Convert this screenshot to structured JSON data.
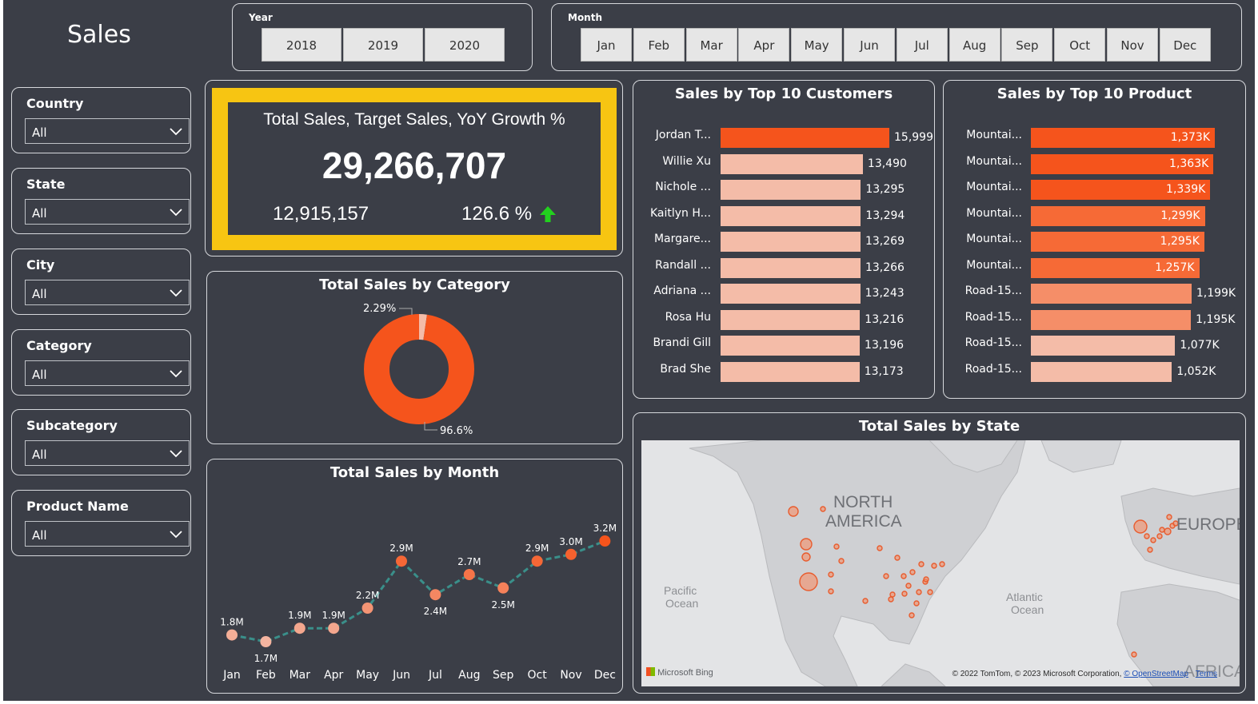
{
  "page_title": "Sales",
  "year_slicer": {
    "label": "Year",
    "options": [
      "2018",
      "2019",
      "2020"
    ]
  },
  "month_slicer": {
    "label": "Month",
    "options": [
      "Jan",
      "Feb",
      "Mar",
      "Apr",
      "May",
      "Jun",
      "Jul",
      "Aug",
      "Sep",
      "Oct",
      "Nov",
      "Dec"
    ]
  },
  "filters": [
    {
      "label": "Country",
      "value": "All"
    },
    {
      "label": "State",
      "value": "All"
    },
    {
      "label": "City",
      "value": "All"
    },
    {
      "label": "Category",
      "value": "All"
    },
    {
      "label": "Subcategory",
      "value": "All"
    },
    {
      "label": "Product Name",
      "value": "All"
    }
  ],
  "kpi": {
    "title": "Total Sales, Target Sales, YoY Growth %",
    "total_sales": "29,266,707",
    "target_sales": "12,915,157",
    "yoy_growth": "126.6 %",
    "colors": {
      "frame": "#f7c512",
      "up_arrow": "#22d11e"
    }
  },
  "category_chart": {
    "title": "Total Sales by Category",
    "label_small": "2.29%",
    "label_large": "96.6%"
  },
  "month_chart": {
    "title": "Total Sales by Month",
    "labels": [
      "1.8M",
      "1.7M",
      "1.9M",
      "1.9M",
      "2.2M",
      "2.9M",
      "2.4M",
      "2.7M",
      "2.5M",
      "2.9M",
      "3.0M",
      "3.2M"
    ],
    "months": [
      "Jan",
      "Feb",
      "Mar",
      "Apr",
      "May",
      "Jun",
      "Jul",
      "Aug",
      "Sep",
      "Oct",
      "Nov",
      "Dec"
    ]
  },
  "customers_chart": {
    "title": "Sales by Top 10 Customers",
    "names": [
      "Jordan T...",
      "Willie Xu",
      "Nichole ...",
      "Kaitlyn H...",
      "Margare...",
      "Randall ...",
      "Adriana ...",
      "Rosa Hu",
      "Brandi Gill",
      "Brad She"
    ],
    "value_labels": [
      "15,999",
      "13,490",
      "13,295",
      "13,294",
      "13,269",
      "13,266",
      "13,243",
      "13,216",
      "13,196",
      "13,173"
    ]
  },
  "products_chart": {
    "title": "Sales by Top 10 Product",
    "names": [
      "Mountai...",
      "Mountai...",
      "Mountai...",
      "Mountai...",
      "Mountai...",
      "Mountai...",
      "Road-15...",
      "Road-15...",
      "Road-15...",
      "Road-15..."
    ],
    "value_labels": [
      "1,373K",
      "1,363K",
      "1,339K",
      "1,299K",
      "1,295K",
      "1,257K",
      "1,199K",
      "1,195K",
      "1,077K",
      "1,052K"
    ]
  },
  "map": {
    "title": "Total Sales by State",
    "region_labels": [
      "NORTH",
      "AMERICA",
      "EUROPE",
      "AFRICA"
    ],
    "ocean_labels": [
      "Pacific",
      "Ocean",
      "Atlantic",
      "Ocean"
    ],
    "brand": "Microsoft Bing",
    "attribution": "© 2022 TomTom, © 2023 Microsoft Corporation, ",
    "osm_link": "© OpenStreetMap",
    "terms_link": "Terms"
  },
  "chart_data": [
    {
      "type": "pie",
      "title": "Total Sales by Category",
      "values": [
        2.29,
        96.6
      ],
      "colors": [
        "#f4bca8",
        "#f5541c"
      ]
    },
    {
      "type": "line",
      "title": "Total Sales by Month",
      "x": [
        "Jan",
        "Feb",
        "Mar",
        "Apr",
        "May",
        "Jun",
        "Jul",
        "Aug",
        "Sep",
        "Oct",
        "Nov",
        "Dec"
      ],
      "y": [
        1.8,
        1.7,
        1.9,
        1.9,
        2.2,
        2.9,
        2.4,
        2.7,
        2.5,
        2.9,
        3.0,
        3.2
      ],
      "y_unit": "M",
      "line_color": "#3a8f8a"
    },
    {
      "type": "bar",
      "orientation": "horizontal",
      "title": "Sales by Top 10 Customers",
      "categories": [
        "Jordan T...",
        "Willie Xu",
        "Nichole ...",
        "Kaitlyn H...",
        "Margare...",
        "Randall ...",
        "Adriana ...",
        "Rosa Hu",
        "Brandi Gill",
        "Brad She"
      ],
      "values": [
        15999,
        13490,
        13295,
        13294,
        13269,
        13266,
        13243,
        13216,
        13196,
        13173
      ],
      "colors": [
        "#f5541c",
        "#f4bca8",
        "#f4bca8",
        "#f4bca8",
        "#f4bca8",
        "#f4bca8",
        "#f4bca8",
        "#f4bca8",
        "#f4bca8",
        "#f4bca8"
      ]
    },
    {
      "type": "bar",
      "orientation": "horizontal",
      "title": "Sales by Top 10 Product",
      "categories": [
        "Mountai...",
        "Mountai...",
        "Mountai...",
        "Mountai...",
        "Mountai...",
        "Mountai...",
        "Road-15...",
        "Road-15...",
        "Road-15...",
        "Road-15..."
      ],
      "values": [
        1373,
        1363,
        1339,
        1299,
        1295,
        1257,
        1199,
        1195,
        1077,
        1052
      ],
      "value_unit": "K",
      "colors": [
        "#f5541c",
        "#f5541c",
        "#f5541c",
        "#f66a36",
        "#f66a36",
        "#f66a36",
        "#f58e68",
        "#f58e68",
        "#f4bca8",
        "#f4bca8"
      ]
    }
  ]
}
